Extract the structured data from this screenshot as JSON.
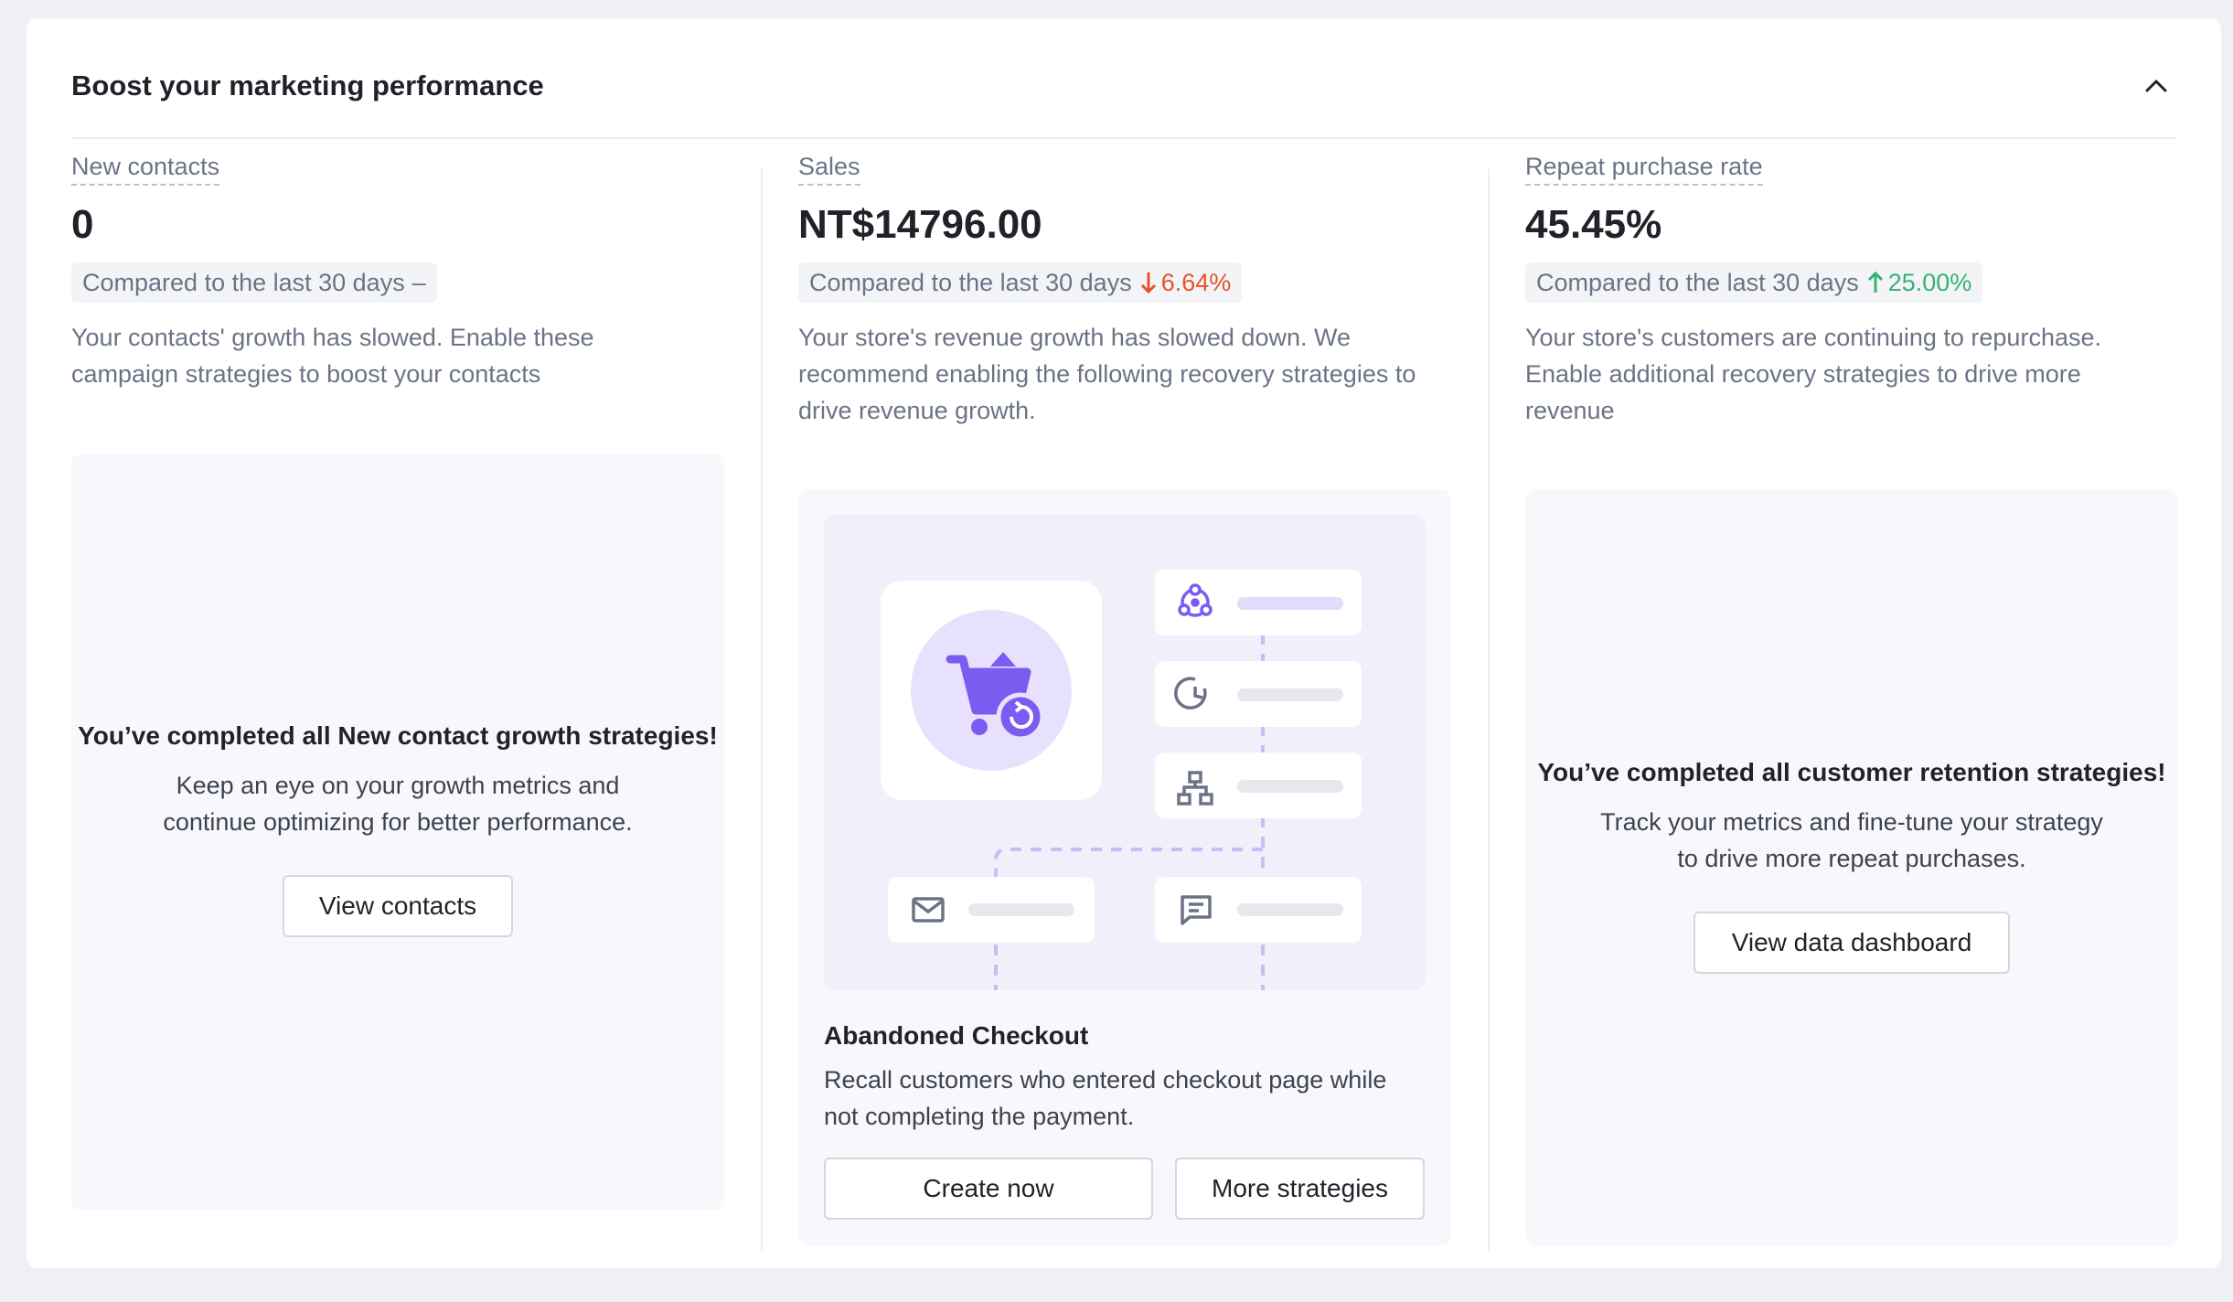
{
  "card": {
    "title": "Boost your marketing performance"
  },
  "columns": {
    "contacts": {
      "label": "New contacts",
      "value": "0",
      "compare_text": "Compared to the last 30 days",
      "delta": "–",
      "description": "Your contacts' growth has slowed. Enable these campaign strategies to boost your contacts",
      "done_title": "You’ve completed all New contact growth strategies!",
      "done_text": "Keep an eye on your growth metrics and continue optimizing for better performance.",
      "button": "View contacts"
    },
    "sales": {
      "label": "Sales",
      "value": "NT$14796.00",
      "compare_text": "Compared to the last 30 days",
      "delta": "6.64%",
      "delta_direction": "down",
      "description": "Your store's revenue growth has slowed down. We recommend enabling the following recovery strategies to drive revenue growth.",
      "strategy_title": "Abandoned Checkout",
      "strategy_desc": "Recall customers who entered checkout page while not completing the payment.",
      "primary_button": "Create now",
      "secondary_button": "More strategies"
    },
    "repeat": {
      "label": "Repeat purchase rate",
      "value": "45.45%",
      "compare_text": "Compared to the last 30 days",
      "delta": "25.00%",
      "delta_direction": "up",
      "description": "Your store's customers are continuing to repurchase. Enable additional recovery strategies to drive more revenue",
      "done_title": "You’ve completed all customer retention strategies!",
      "done_text": "Track your metrics and fine-tune your strategy to drive more repeat purchases.",
      "button": "View data dashboard"
    }
  },
  "colors": {
    "accent": "#7b5cf0",
    "down": "#e8532a",
    "up": "#36b374"
  },
  "icons": {
    "collapse": "chevron-up-icon",
    "cart": "shopping-cart-icon",
    "segment": "audience-segment-icon",
    "timer": "timer-icon",
    "split": "flow-split-icon",
    "email": "email-icon",
    "sms": "message-icon"
  }
}
